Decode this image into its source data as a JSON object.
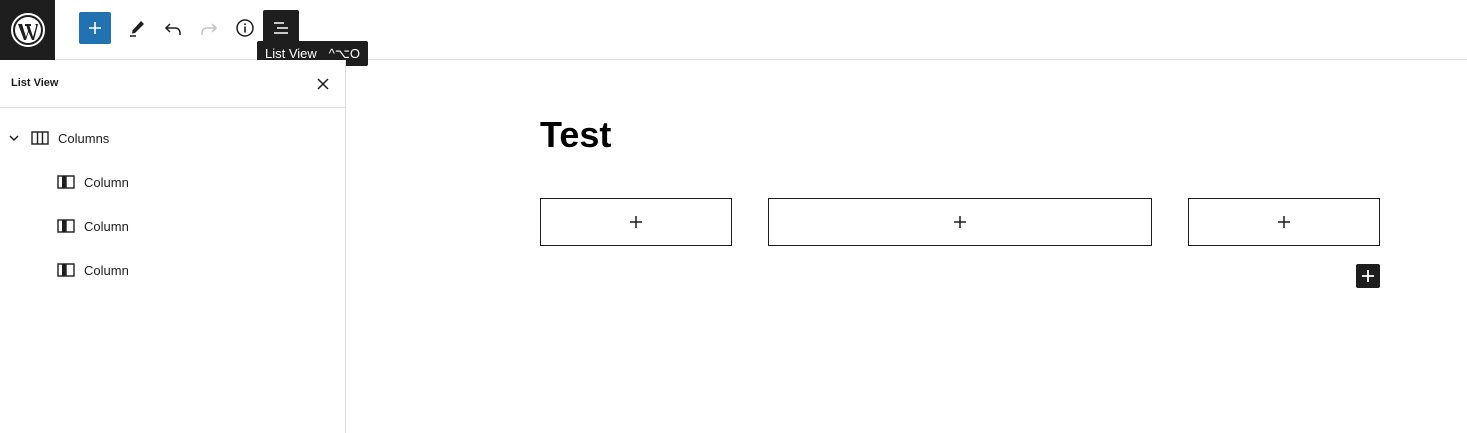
{
  "toolbar": {
    "logo_icon": "wordpress-logo-icon",
    "add_block_icon": "plus-icon",
    "tools_icon": "pencil-icon",
    "undo_icon": "undo-icon",
    "redo_icon": "redo-icon",
    "details_icon": "info-icon",
    "list_view_icon": "list-view-icon",
    "accent_color": "#2271b1"
  },
  "tooltip": {
    "label": "List View",
    "shortcut": "^⌥O"
  },
  "list_view": {
    "title": "List View",
    "close_icon": "close-icon",
    "items": [
      {
        "label": "Columns",
        "icon": "columns-icon",
        "level": 1,
        "expanded": true
      },
      {
        "label": "Column",
        "icon": "column-icon",
        "level": 2
      },
      {
        "label": "Column",
        "icon": "column-icon",
        "level": 2
      },
      {
        "label": "Column",
        "icon": "column-icon",
        "level": 2
      }
    ]
  },
  "editor": {
    "post_title": "Test",
    "columns_count": 3
  }
}
